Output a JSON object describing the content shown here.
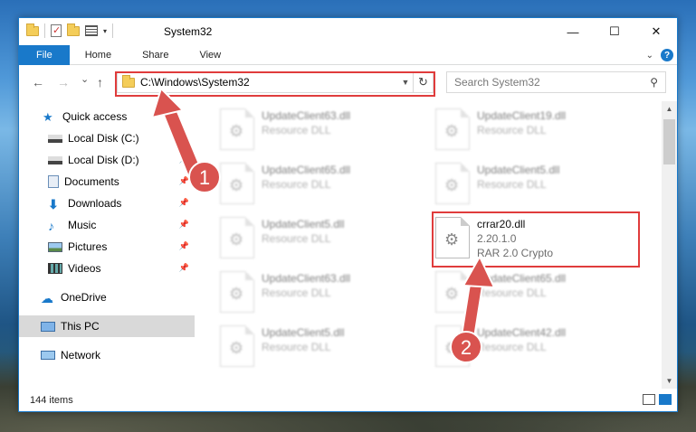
{
  "window": {
    "title": "System32",
    "controls": {
      "minimize": "—",
      "maximize": "☐",
      "close": "✕"
    }
  },
  "ribbon": {
    "tabs": [
      "File",
      "Home",
      "Share",
      "View"
    ]
  },
  "navigation": {
    "back": "←",
    "forward": "→",
    "recent": "⌄",
    "up": "↑",
    "address": "C:\\Windows\\System32",
    "search_placeholder": "Search System32"
  },
  "sidebar": {
    "items": [
      {
        "label": "Quick access",
        "icon": "star-icon"
      },
      {
        "label": "Local Disk (C:)",
        "icon": "drive-icon"
      },
      {
        "label": "Local Disk (D:)",
        "icon": "drive-icon"
      },
      {
        "label": "Documents",
        "icon": "documents-icon"
      },
      {
        "label": "Downloads",
        "icon": "downloads-icon"
      },
      {
        "label": "Music",
        "icon": "music-icon"
      },
      {
        "label": "Pictures",
        "icon": "pictures-icon"
      },
      {
        "label": "Videos",
        "icon": "videos-icon"
      },
      {
        "label": "OneDrive",
        "icon": "cloud-icon"
      },
      {
        "label": "This PC",
        "icon": "computer-icon",
        "selected": true
      },
      {
        "label": "Network",
        "icon": "network-icon"
      }
    ]
  },
  "files": [
    {
      "name": "UpdateClient63.dll",
      "type": "Resource DLL"
    },
    {
      "name": "UpdateClient19.dll",
      "type": "Resource DLL"
    },
    {
      "name": "UpdateClient65.dll",
      "type": "Resource DLL"
    },
    {
      "name": "UpdateClient5.dll",
      "type": "Resource DLL"
    },
    {
      "name": "UpdateClient5.dll",
      "type": "Resource DLL"
    },
    {
      "name": "crrar20.dll",
      "version": "2.20.1.0",
      "type": "RAR 2.0 Crypto",
      "highlighted": true
    },
    {
      "name": "UpdateClient63.dll",
      "type": "Resource DLL"
    },
    {
      "name": "UpdateClient65.dll",
      "type": "Resource DLL"
    },
    {
      "name": "UpdateClient5.dll",
      "type": "Resource DLL"
    },
    {
      "name": "UpdateClient42.dll",
      "type": "Resource DLL"
    }
  ],
  "status": {
    "item_count": "144 items"
  },
  "callouts": [
    "1",
    "2"
  ],
  "colors": {
    "accent": "#1979ca",
    "highlight": "#e03c3c"
  }
}
